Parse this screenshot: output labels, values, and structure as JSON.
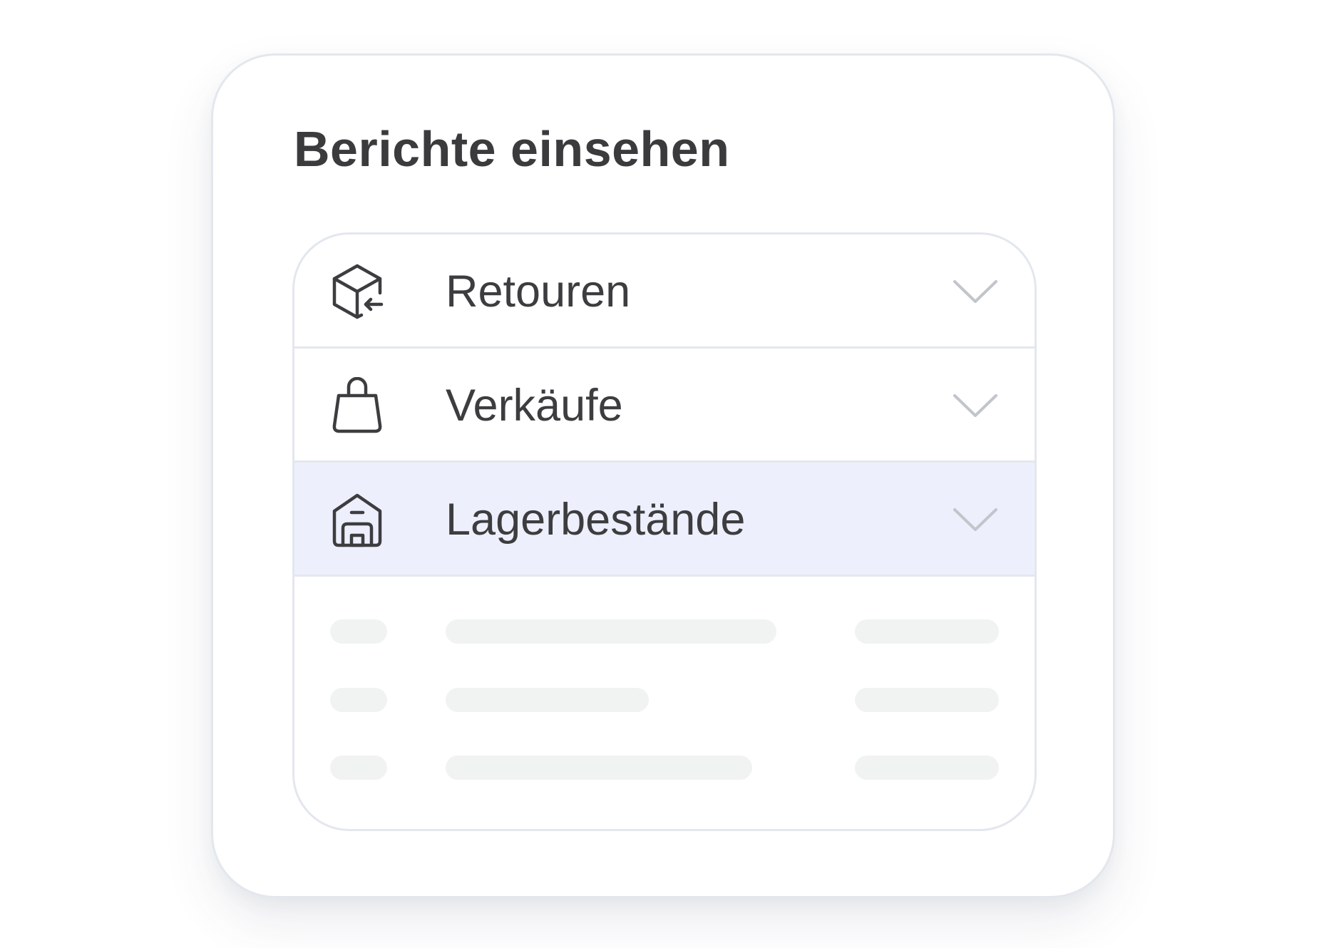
{
  "card": {
    "title": "Berichte einsehen"
  },
  "report_list": {
    "items": [
      {
        "label": "Retouren",
        "icon": "box-return-icon",
        "expanded": false
      },
      {
        "label": "Verkäufe",
        "icon": "shopping-bag-icon",
        "expanded": false
      },
      {
        "label": "Lagerbestände",
        "icon": "warehouse-icon",
        "expanded": true
      }
    ],
    "placeholder_rows": 3
  },
  "colors": {
    "title_text": "#3b3b3d",
    "row_text": "#3d3d40",
    "border": "#e3e7ee",
    "active_row_bg": "#edf0fc",
    "chevron": "#c2c5ca",
    "icon_stroke": "#3d3d40",
    "skeleton": "#f1f2f2"
  }
}
